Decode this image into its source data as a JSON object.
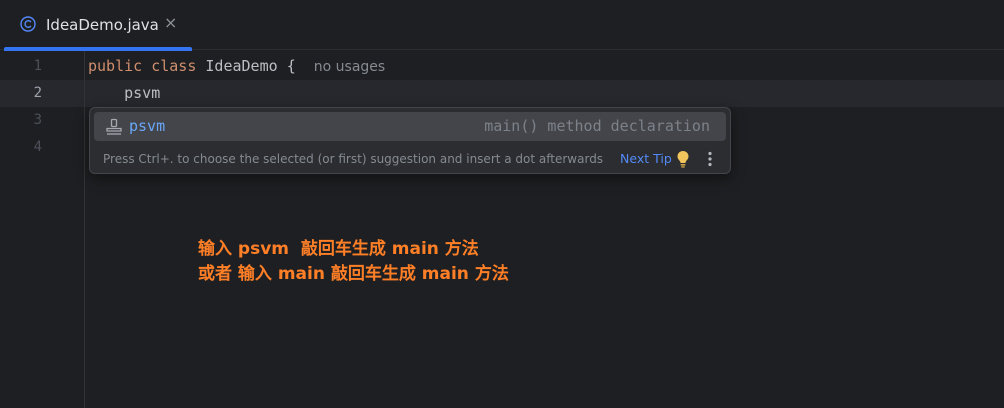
{
  "tab": {
    "title": "IdeaDemo.java",
    "close": "×",
    "icon": "java-class-icon"
  },
  "editor": {
    "line_numbers": [
      "1",
      "2",
      "3",
      "4"
    ],
    "line1": {
      "kw1": "public",
      "kw2": "class",
      "class_name": "IdeaDemo",
      "brace": "{",
      "hint": "no usages"
    },
    "line2": {
      "text": "psvm"
    }
  },
  "popup": {
    "item": {
      "name": "psvm",
      "description": "main() method declaration",
      "icon": "live-template-icon"
    },
    "footer": "Press Ctrl+. to choose the selected (or first) suggestion and insert a dot afterwards",
    "next_tip": "Next Tip",
    "bulb_icon": "lightbulb-icon",
    "more_icon": "more-vertical-icon"
  },
  "annotation": {
    "line1": "输入 psvm  敲回车生成 main 方法",
    "line2": "或者 输入 main 敲回车生成 main 方法"
  },
  "colors": {
    "background": "#1e1f22",
    "accent": "#3574f0",
    "keyword": "#cf8e6d",
    "annotation": "#ff7f27"
  }
}
